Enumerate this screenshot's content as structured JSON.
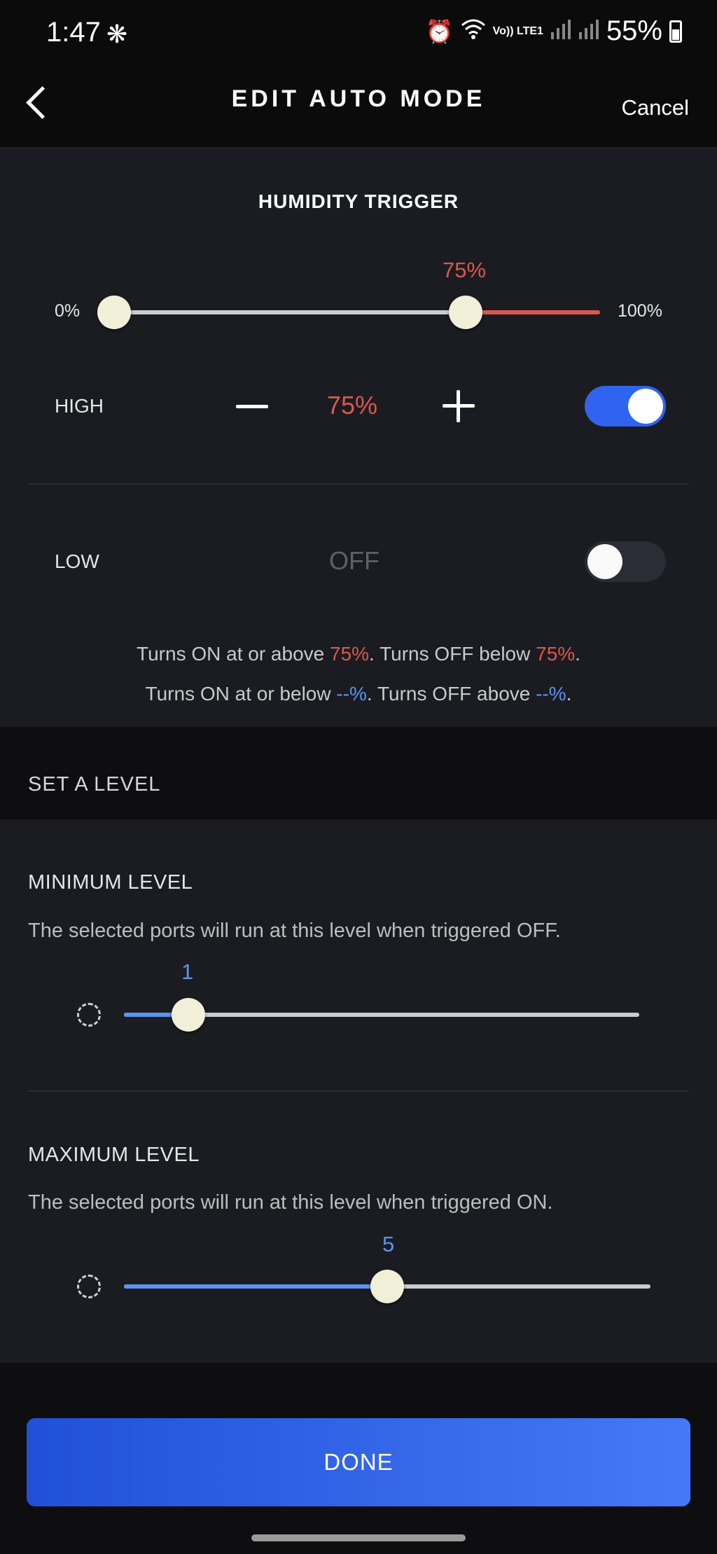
{
  "status_bar": {
    "time": "1:47",
    "fan_icon": "fan-icon",
    "alarm_icon": "alarm-icon",
    "wifi_icon": "wifi-icon",
    "lte_label": "Vo)) LTE1",
    "battery_pct": "55%"
  },
  "header": {
    "title": "EDIT AUTO MODE",
    "cancel_label": "Cancel",
    "back_icon": "back-chevron-icon"
  },
  "humidity_trigger": {
    "title": "HUMIDITY TRIGGER",
    "slider": {
      "min_label": "0%",
      "max_label": "100%",
      "value_label": "75%",
      "value_percent": 75,
      "low_knob_percent": 0
    },
    "high": {
      "label": "HIGH",
      "value": "75%",
      "enabled": true
    },
    "low": {
      "label": "LOW",
      "value": "OFF",
      "enabled": false
    },
    "note_high": {
      "part1": "Turns ON at or above ",
      "val1": "75%",
      "part2": ". Turns OFF below ",
      "val2": "75%",
      "part3": "."
    },
    "note_low": {
      "part1": "Turns ON at or below ",
      "val1": "--%",
      "part2": ". Turns OFF above ",
      "val2": "--%",
      "part3": "."
    }
  },
  "set_level": {
    "title": "SET A LEVEL",
    "minimum": {
      "title": "MINIMUM LEVEL",
      "description": "The selected ports will run at this level when triggered OFF.",
      "value": "1",
      "fraction": 0.125
    },
    "maximum": {
      "title": "MAXIMUM LEVEL",
      "description": "The selected ports will run at this level when triggered ON.",
      "value": "5",
      "fraction": 0.5
    }
  },
  "done_label": "DONE",
  "colors": {
    "accent_red": "#d9594f",
    "accent_blue": "#5b94f0",
    "toggle_on": "#2f64f0",
    "toggle_off": "#2a2d35",
    "button_gradient_start": "#2150d8",
    "button_gradient_end": "#4579f5"
  }
}
